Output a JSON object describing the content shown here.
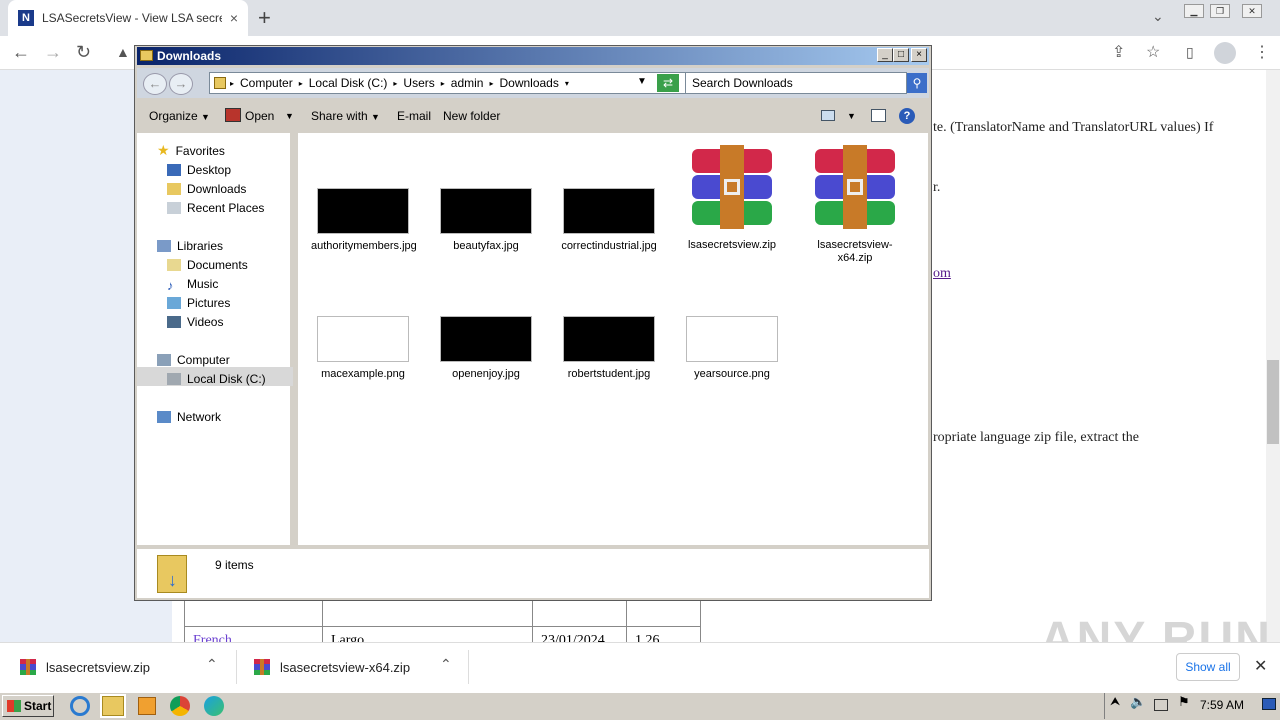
{
  "browser": {
    "tab_title": "LSASecretsView - View LSA secrets s",
    "tab_favicon_letter": "N",
    "close_glyph": "×",
    "newtab_glyph": "+"
  },
  "webpage": {
    "text1": "te. (TranslatorName and TranslatorURL values) If",
    "text2": "r.",
    "link1": "om",
    "text3": "ropriate language zip file, extract the",
    "table_row_lang": "French",
    "table_row_translator": "Largo",
    "table_row_date": "23/01/2024",
    "table_row_version": "1.26"
  },
  "explorer": {
    "title": "Downloads",
    "breadcrumb": [
      "Computer",
      "Local Disk (C:)",
      "Users",
      "admin",
      "Downloads"
    ],
    "search_placeholder": "Search Downloads",
    "commands": {
      "organize": "Organize",
      "open": "Open",
      "share_with": "Share with",
      "email": "E-mail",
      "new_folder": "New folder"
    },
    "nav": {
      "favorites": "Favorites",
      "desktop": "Desktop",
      "downloads": "Downloads",
      "recent_places": "Recent Places",
      "libraries": "Libraries",
      "documents": "Documents",
      "music": "Music",
      "pictures": "Pictures",
      "videos": "Videos",
      "computer": "Computer",
      "local_disk": "Local Disk (C:)",
      "network": "Network"
    },
    "files": {
      "f1": "authoritymembers.jpg",
      "f2": "beautyfax.jpg",
      "f3": "correctindustrial.jpg",
      "f4": "lsasecretsview.zip",
      "f5": "lsasecretsview-x64.zip",
      "f6": "macexample.png",
      "f7": "openenjoy.jpg",
      "f8": "robertstudent.jpg",
      "f9": "yearsource.png"
    },
    "status": "9 items"
  },
  "downloads_bar": {
    "item1": "lsasecretsview.zip",
    "item2": "lsasecretsview-x64.zip",
    "show_all": "Show all"
  },
  "taskbar": {
    "start": "Start",
    "clock": "7:59 AM"
  },
  "watermark": "ANY RUN",
  "colors": {
    "title_gradient_start": "#0a246a",
    "title_gradient_end": "#a6caf0",
    "link": "#551a8b",
    "accent_blue": "#1a73e8"
  }
}
